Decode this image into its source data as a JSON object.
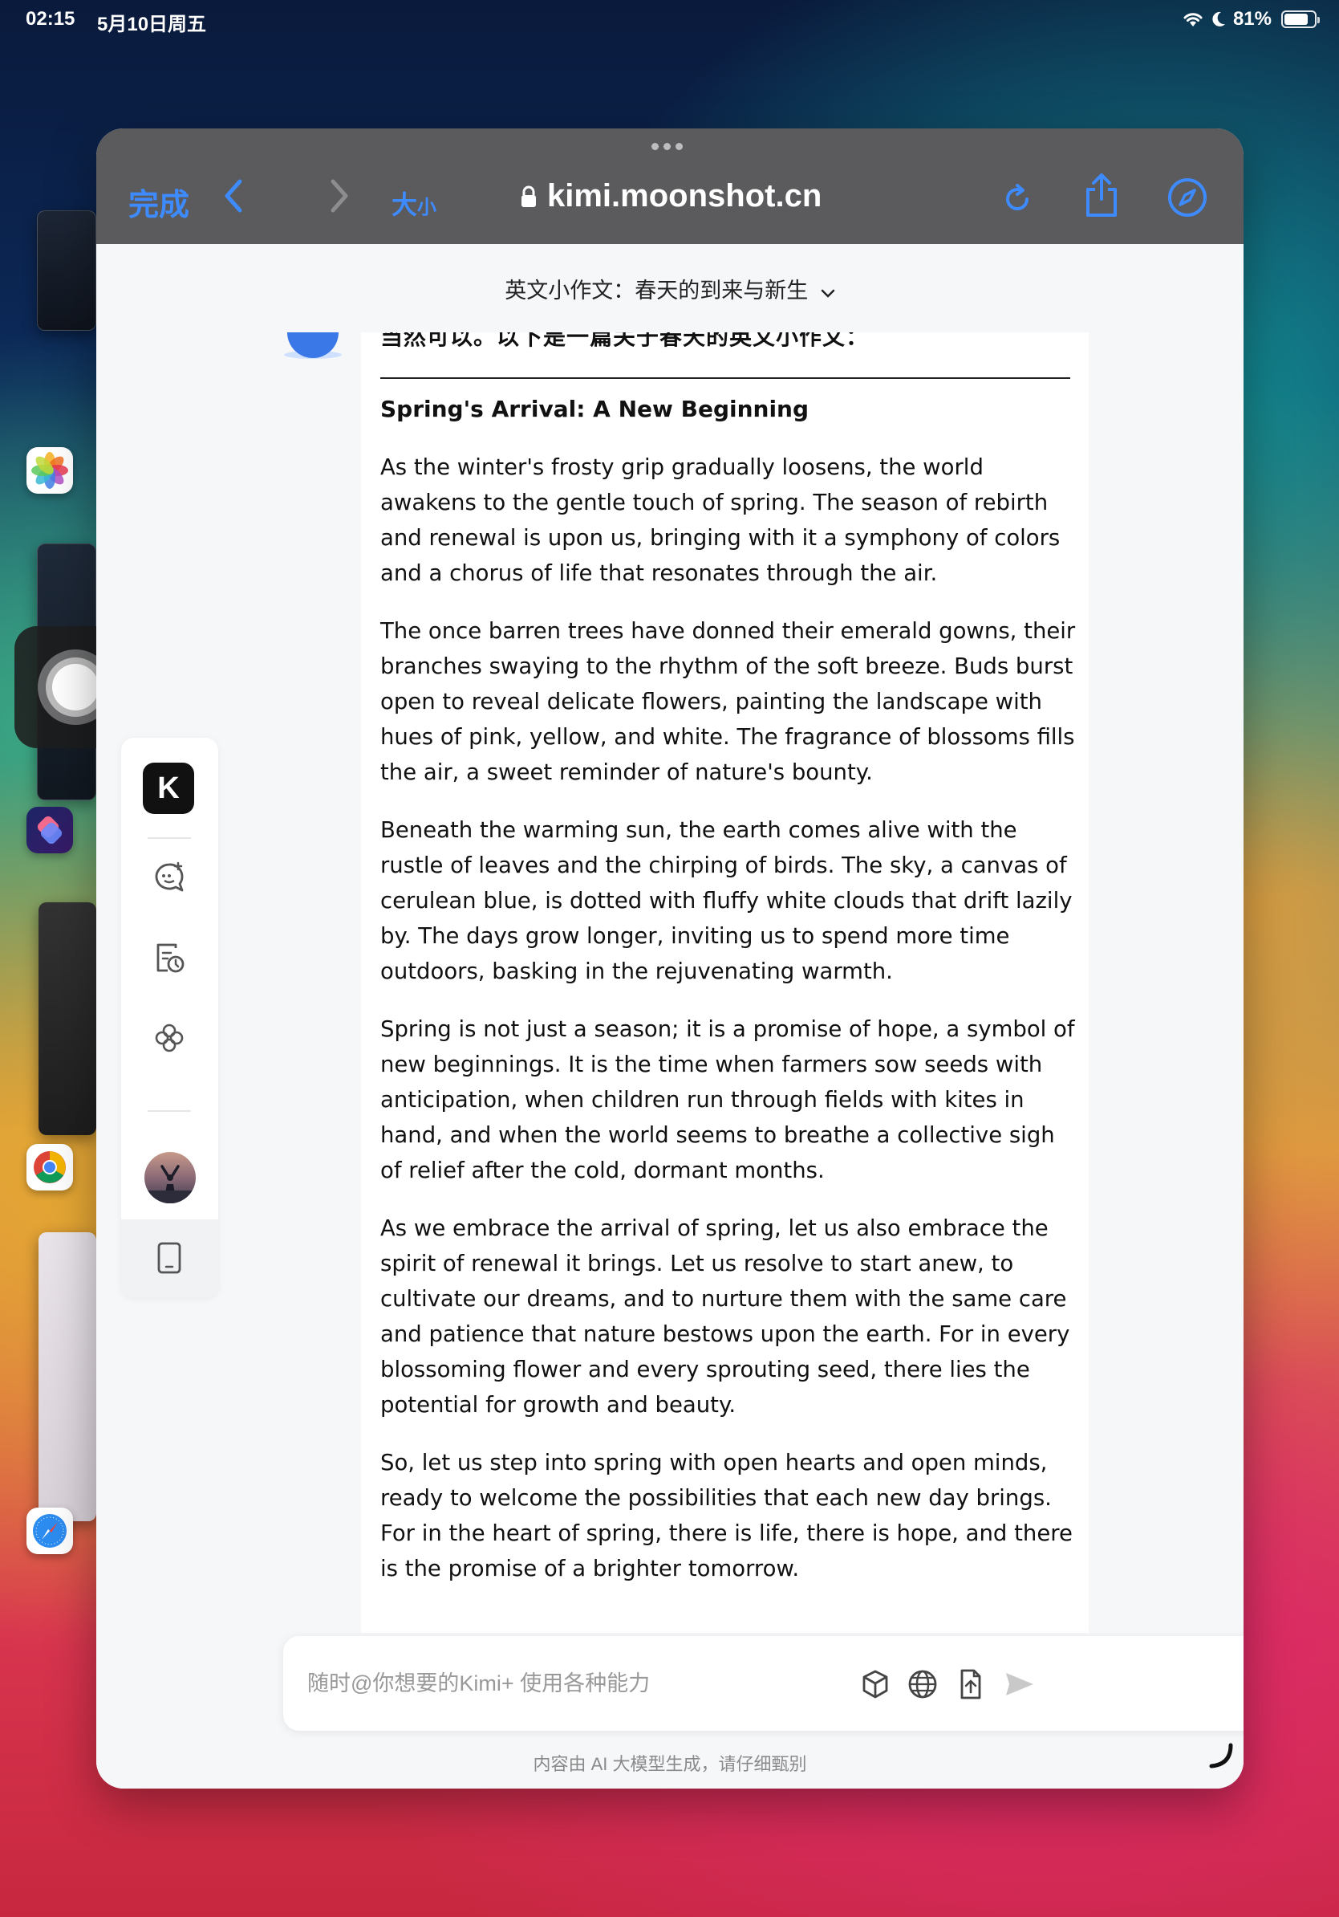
{
  "status_bar": {
    "time": "02:15",
    "date": "5月10日周五",
    "battery": "81%",
    "battery_level": 0.81
  },
  "browser": {
    "done_label": "完成",
    "text_size_big": "大",
    "text_size_small": "小",
    "url": "kimi.moonshot.cn"
  },
  "chat": {
    "title": "英文小作文：春天的到来与新生",
    "partial_line": "当然可以。以下是一篇关于春天的英文小作文：",
    "essay_title": "Spring's Arrival: A New Beginning",
    "paragraphs": [
      "As the winter's frosty grip gradually loosens, the world awakens to the gentle touch of spring. The season of rebirth and renewal is upon us, bringing with it a symphony of colors and a chorus of life that resonates through the air.",
      "The once barren trees have donned their emerald gowns, their branches swaying to the rhythm of the soft breeze. Buds burst open to reveal delicate flowers, painting the landscape with hues of pink, yellow, and white. The fragrance of blossoms fills the air, a sweet reminder of nature's bounty.",
      "Beneath the warming sun, the earth comes alive with the rustle of leaves and the chirping of birds. The sky, a canvas of cerulean blue, is dotted with fluffy white clouds that drift lazily by. The days grow longer, inviting us to spend more time outdoors, basking in the rejuvenating warmth.",
      "Spring is not just a season; it is a promise of hope, a symbol of new beginnings. It is the time when farmers sow seeds with anticipation, when children run through fields with kites in hand, and when the world seems to breathe a collective sigh of relief after the cold, dormant months.",
      "As we embrace the arrival of spring, let us also embrace the spirit of renewal it brings. Let us resolve to start anew, to cultivate our dreams, and to nurture them with the same care and patience that nature bestows upon the earth. For in every blossoming flower and every sprouting seed, there lies the potential for growth and beauty.",
      "So, let us step into spring with open hearts and open minds, ready to welcome the possibilities that each new day brings. For in the heart of spring, there is life, there is hope, and there is the promise of a brighter tomorrow."
    ]
  },
  "sidebar": {
    "logo_letter": "K"
  },
  "input": {
    "placeholder": "随时@你想要的Kimi+ 使用各种能力"
  },
  "footer": {
    "disclaimer": "内容由 AI 大模型生成，请仔细甄别"
  },
  "icons": {
    "accent": "#3d8bff"
  }
}
